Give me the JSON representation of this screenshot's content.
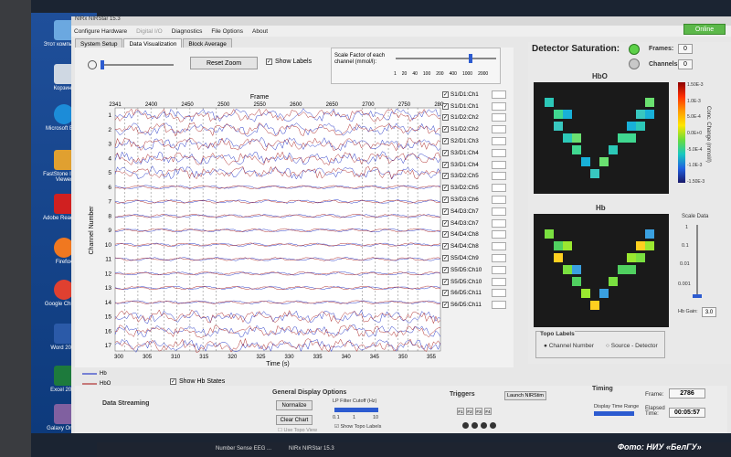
{
  "window": {
    "title": "NIRx NIRStar 15.3",
    "online_button": "Online"
  },
  "menu": [
    "Configure Hardware",
    "Digital I/O",
    "Diagnostics",
    "File Options",
    "About"
  ],
  "tabs": [
    "System Setup",
    "Data Visualization",
    "Block Average"
  ],
  "toolbar": {
    "reset_zoom": "Reset Zoom",
    "show_labels": "Show Labels",
    "scale_label": "Scale Factor of each channel (mmol/l):",
    "scale_ticks": [
      "1",
      "20",
      "40",
      "100",
      "200",
      "400",
      "1000",
      "2000"
    ]
  },
  "plot": {
    "top_label": "Frame",
    "frame_ticks": [
      "2341",
      "2400",
      "2450",
      "2500",
      "2550",
      "2600",
      "2650",
      "2700",
      "2750",
      "2809"
    ],
    "x_label": "Time (s)",
    "x_ticks": [
      "300",
      "305",
      "310",
      "315",
      "320",
      "325",
      "330",
      "335",
      "340",
      "345",
      "350",
      "355"
    ],
    "y_label": "Channel Number",
    "y_ticks": [
      "1",
      "2",
      "3",
      "4",
      "5",
      "6",
      "7",
      "8",
      "9",
      "10",
      "11",
      "12",
      "13",
      "14",
      "15",
      "16",
      "17"
    ]
  },
  "channels": [
    "S1/D1:Ch1",
    "S1/D1:Ch1",
    "S1/D2:Ch2",
    "S1/D2:Ch2",
    "S2/D1:Ch3",
    "S3/D1:Ch4",
    "S3/D1:Ch4",
    "S3/D2:Ch5",
    "S3/D2:Ch5",
    "S3/D3:Ch6",
    "S4/D3:Ch7",
    "S4/D3:Ch7",
    "S4/D4:Ch8",
    "S4/D4:Ch8",
    "S5/D4:Ch9",
    "S5/D5:Ch10",
    "S5/D5:Ch10",
    "S6/D5:Ch11",
    "S6/D5:Ch11"
  ],
  "legend": {
    "hb": "Hb",
    "hbo": "HbO",
    "show_hb_states": "Show Hb States"
  },
  "detector": {
    "title": "Detector Saturation:",
    "frames_label": "Frames:",
    "frames_value": "0",
    "channels_label": "Channels:",
    "channels_value": "0",
    "map_hbo": "HbO",
    "map_hb": "Hb",
    "cbar_label": "Conc. Change (mmol/l)",
    "cbar_ticks": [
      "1.50E-3",
      "1.0E-3",
      "5.0E-4",
      "0.0E+0",
      "-5.0E-4",
      "-1.0E-3",
      "-1.50E-3"
    ],
    "scale_data": "Scale Data",
    "scale_ticks": [
      "1",
      "0.1",
      "0.01",
      "0.001"
    ],
    "hb_gain_label": "Hb Gain:",
    "hb_gain_value": "3.0"
  },
  "topo": {
    "title": "Topo Labels",
    "opt1": "Channel Number",
    "opt2": "Source - Detector"
  },
  "bottom": {
    "data_streaming": "Data Streaming",
    "general_title": "General Display Options",
    "normalize": "Normalize",
    "clear_chart": "Clear Chart",
    "use_topo_view": "Use Topo View",
    "lp_filter": "LP Filter Cutoff (Hz)",
    "lp_ticks": [
      "0.1",
      "1",
      "10"
    ],
    "show_topo_labels": "Show Topo Labels",
    "triggers": "Triggers",
    "launch": "Launch NIRStim",
    "trigger_buttons": [
      "F1",
      "F2",
      "F3",
      "F4"
    ],
    "timing": "Timing",
    "frame_label": "Frame:",
    "frame_value": "2786",
    "elapsed_label": "Elapsed Time:",
    "elapsed_value": "00:05:57",
    "display_range": "Display Time Range"
  },
  "desktop_icons": [
    "Этот компьютер",
    "Корзина",
    "Microsoft Edge",
    "FastStone Image Viewer",
    "Adobe Reader XI",
    "Firefox",
    "Google Chrome",
    "Word 2016",
    "Excel 2016",
    "Galaxy Online"
  ],
  "taskbar": {
    "item1": "Number Sense EEG ...",
    "item2": "NIRx NIRStar 15.3"
  },
  "credit": "Фото: НИУ «БелГУ»",
  "colors": {
    "hb_trace": "#2c3cc8",
    "hbo_trace": "#b03030",
    "online": "#5cb84a"
  }
}
